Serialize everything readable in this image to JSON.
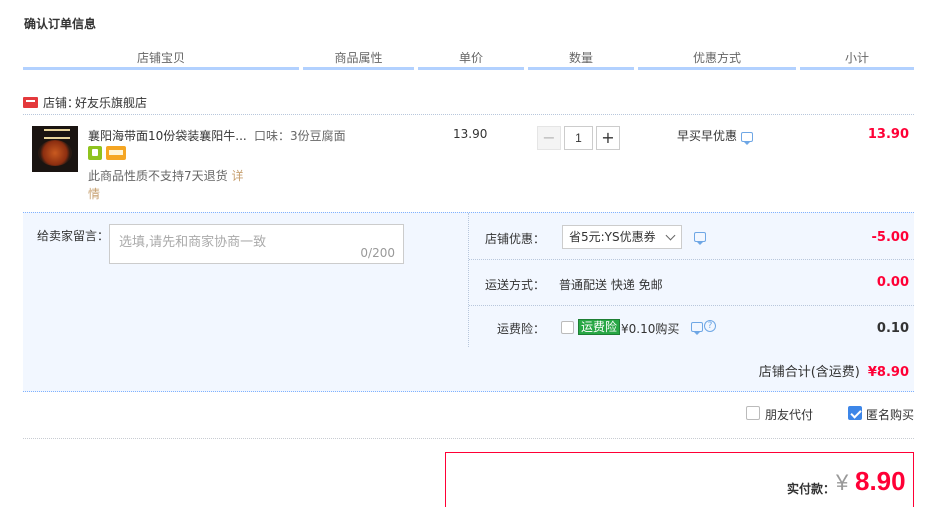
{
  "title": "确认订单信息",
  "columns": [
    "店铺宝贝",
    "商品属性",
    "单价",
    "数量",
    "优惠方式",
    "小计"
  ],
  "shop": {
    "label": "店铺：",
    "name": "好友乐旗舰店"
  },
  "item": {
    "title": "襄阳海带面10份袋装襄阳牛...",
    "attribute": "口味：3份豆腐面",
    "refund_note": "此商品性质不支持7天退货",
    "refund_detail": "详情",
    "price": "13.90",
    "quantity": "1",
    "qty_minus": "−",
    "qty_plus": "+",
    "promo": "早买早优惠",
    "subtotal": "13.90"
  },
  "message": {
    "label": "给卖家留言：",
    "placeholder": "选填,请先和商家协商一致",
    "counter": "0/200"
  },
  "shop_discount": {
    "label": "店铺优惠：",
    "selected": "省5元:YS优惠券",
    "value": "-5.00",
    "color": "#ff0036"
  },
  "shipping": {
    "label": "运送方式：",
    "method": "普通配送 快递 免邮",
    "value": "0.00",
    "color": "#ff0036"
  },
  "insurance": {
    "label": "运费险：",
    "tag": "运费险",
    "text": "¥0.10购买",
    "value": "0.10",
    "checked": false
  },
  "shop_total": {
    "label": "店铺合计(含运费)",
    "amount": "¥8.90"
  },
  "options": {
    "friend_pay": {
      "label": "朋友代付",
      "checked": false
    },
    "anonymous": {
      "label": "匿名购买",
      "checked": true
    }
  },
  "payment": {
    "label": "实付款：",
    "currency": "¥",
    "amount": "8.90"
  },
  "icons": [
    "tmall-icon",
    "chat-icon",
    "help-icon",
    "checkbox-icon",
    "chevron-down-icon"
  ]
}
